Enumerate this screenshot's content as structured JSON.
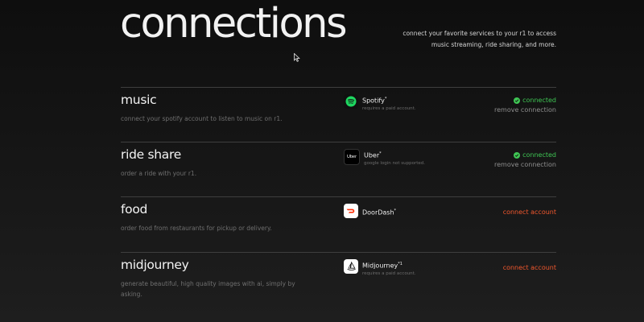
{
  "header": {
    "title": "connections",
    "intro_line1": "connect your favorite services to your r1 to access",
    "intro_line2": "music streaming, ride sharing, and more."
  },
  "colors": {
    "connected": "#3fc554",
    "connect_action": "#f0572d",
    "spotify": "#1ed760",
    "doordash": "#ff3008"
  },
  "sections": [
    {
      "title": "music",
      "description": "connect your spotify account to listen to music on r1.",
      "service": {
        "name": "Spotify",
        "mark": "*",
        "note": "requires a paid account.",
        "icon": "spotify-icon"
      },
      "status": {
        "label": "connected",
        "action": "remove connection"
      }
    },
    {
      "title": "ride share",
      "description": "order a ride with your r1.",
      "service": {
        "name": "Uber",
        "mark": "*",
        "note": "google login not supported.",
        "icon": "uber-icon",
        "logo_text": "Uber"
      },
      "status": {
        "label": "connected",
        "action": "remove connection"
      }
    },
    {
      "title": "food",
      "description": "order food from restaurants for pickup or delivery.",
      "service": {
        "name": "DoorDash",
        "mark": "*",
        "note": "",
        "icon": "doordash-icon"
      },
      "status": {
        "action": "connect account"
      }
    },
    {
      "title": "midjourney",
      "description": "generate beautiful, high quality images with ai, simply by asking.",
      "service": {
        "name": "Midjourney",
        "mark": "*1",
        "note": "requires a paid account.",
        "icon": "midjourney-icon"
      },
      "status": {
        "action": "connect account"
      }
    }
  ]
}
